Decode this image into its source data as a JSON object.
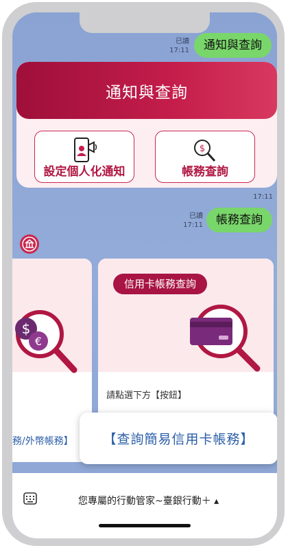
{
  "chat": {
    "msg1": {
      "status": "已讀",
      "time": "17:11",
      "text": "通知與查詢"
    },
    "card": {
      "title": "通知與查詢",
      "left_button": "設定個人化通知",
      "right_button": "帳務查詢",
      "time": "17:11"
    },
    "msg2": {
      "status": "已讀",
      "time": "17:11",
      "text": "帳務查詢"
    }
  },
  "carousel": {
    "left_card": {
      "footer": "務/外幣帳務】"
    },
    "right_card": {
      "pill": "信用卡帳務查詢",
      "hint": "請點選下方【按鈕】"
    }
  },
  "popup": {
    "text": "【查詢簡易信用卡帳務】"
  },
  "bottom": {
    "menu_text": "您專屬的行動管家~臺銀行動＋ ▴"
  },
  "colors": {
    "brand": "#b01742",
    "green_bubble": "#79d66a",
    "link_blue": "#2b5ea8"
  }
}
